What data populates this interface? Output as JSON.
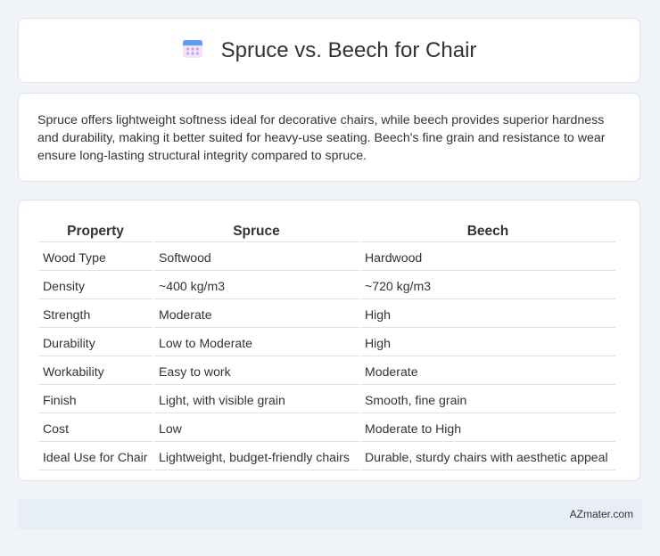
{
  "header": {
    "title": "Spruce vs. Beech for Chair",
    "icon": "calendar-icon"
  },
  "summary": {
    "text": "Spruce offers lightweight softness ideal for decorative chairs, while beech provides superior hardness and durability, making it better suited for heavy-use seating. Beech's fine grain and resistance to wear ensure long-lasting structural integrity compared to spruce."
  },
  "table": {
    "headers": [
      "Property",
      "Spruce",
      "Beech"
    ],
    "rows": [
      [
        "Wood Type",
        "Softwood",
        "Hardwood"
      ],
      [
        "Density",
        "~400 kg/m3",
        "~720 kg/m3"
      ],
      [
        "Strength",
        "Moderate",
        "High"
      ],
      [
        "Durability",
        "Low to Moderate",
        "High"
      ],
      [
        "Workability",
        "Easy to work",
        "Moderate"
      ],
      [
        "Finish",
        "Light, with visible grain",
        "Smooth, fine grain"
      ],
      [
        "Cost",
        "Low",
        "Moderate to High"
      ],
      [
        "Ideal Use for Chair",
        "Lightweight, budget-friendly chairs",
        "Durable, sturdy chairs with aesthetic appeal"
      ]
    ]
  },
  "footer": {
    "brand": "AZmater.com"
  },
  "colors": {
    "background": "#f0f3f8",
    "card": "#ffffff",
    "footer": "#e8eef8",
    "border": "#dee3ea"
  }
}
